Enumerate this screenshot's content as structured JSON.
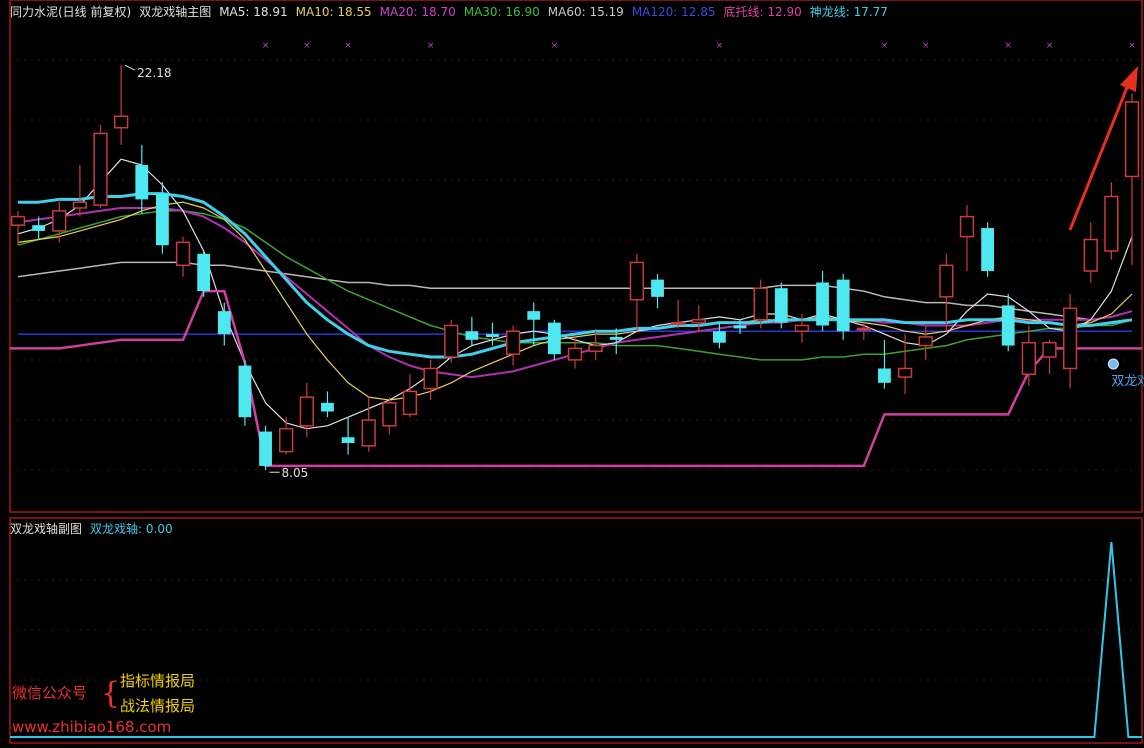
{
  "header": {
    "stock_title": "同力水泥(日线 前复权)",
    "indicator_name": "双龙戏轴主图",
    "items": [
      {
        "label": "MA5: 18.91",
        "color": "#e0e0e0"
      },
      {
        "label": "MA10: 18.55",
        "color": "#e8d060"
      },
      {
        "label": "MA20: 18.70",
        "color": "#d040d0"
      },
      {
        "label": "MA30: 16.90",
        "color": "#40c040"
      },
      {
        "label": "MA60: 15.19",
        "color": "#c8c8c8"
      },
      {
        "label": "MA120: 12.85",
        "color": "#3050e0"
      },
      {
        "label": "底托线: 12.90",
        "color": "#e040a0"
      },
      {
        "label": "神龙线: 17.77",
        "color": "#40d0e8"
      }
    ]
  },
  "sub_header": {
    "name": "双龙戏轴副图",
    "item": "双龙戏轴: 0.00"
  },
  "annotations": {
    "high_label": "22.18",
    "low_label": "8.05",
    "signal_label": "双龙戏轴"
  },
  "watermark": {
    "wechat": "微信公众号",
    "brace": "{",
    "line1": "指标情报局",
    "line2": "战法情报局",
    "url": "www.zhibiao168.com"
  },
  "colors": {
    "up": "#c83c3c",
    "down": "#50e8f0",
    "frame": "#7a1414",
    "ma5": "#e0e0e0",
    "ma10": "#e8d060",
    "ma20": "#b030b0",
    "ma30": "#40a030",
    "ma60": "#b8b8b8",
    "ma120": "#2838d8",
    "base": "#d040a0",
    "dragon": "#40d0e8",
    "sub": "#30c8e8",
    "arrow": "#e83020"
  },
  "chart_data": {
    "type": "candlestick",
    "price_range": [
      7.5,
      23.2
    ],
    "highest": 22.18,
    "lowest": 8.05,
    "candles": [
      [
        16.6,
        16.9,
        17.1,
        15.9
      ],
      [
        16.6,
        16.4,
        16.9,
        16.1
      ],
      [
        16.4,
        17.1,
        17.5,
        16.0
      ],
      [
        17.2,
        17.4,
        18.7,
        16.9
      ],
      [
        17.3,
        19.8,
        20.1,
        17.2
      ],
      [
        20.0,
        20.4,
        22.18,
        19.4
      ],
      [
        18.7,
        17.5,
        19.4,
        17.0
      ],
      [
        17.7,
        15.9,
        18.1,
        15.6
      ],
      [
        15.2,
        16.0,
        16.2,
        14.8
      ],
      [
        15.6,
        14.3,
        15.7,
        14.1
      ],
      [
        13.6,
        12.8,
        13.9,
        12.4
      ],
      [
        11.7,
        9.9,
        11.9,
        9.6
      ],
      [
        9.4,
        8.2,
        9.6,
        8.05
      ],
      [
        8.7,
        9.5,
        9.9,
        8.6
      ],
      [
        9.6,
        10.6,
        11.1,
        9.2
      ],
      [
        10.4,
        10.1,
        10.8,
        9.9
      ],
      [
        9.2,
        9.0,
        9.9,
        8.6
      ],
      [
        8.9,
        9.8,
        10.6,
        8.7
      ],
      [
        9.6,
        10.4,
        10.6,
        9.3
      ],
      [
        10.0,
        10.8,
        11.4,
        9.9
      ],
      [
        10.9,
        11.6,
        11.9,
        10.5
      ],
      [
        12.0,
        13.1,
        13.3,
        11.8
      ],
      [
        12.9,
        12.6,
        13.4,
        12.4
      ],
      [
        12.8,
        12.7,
        13.2,
        12.4
      ],
      [
        12.1,
        12.9,
        13.1,
        11.7
      ],
      [
        13.6,
        13.3,
        13.9,
        12.4
      ],
      [
        13.2,
        12.1,
        13.3,
        11.9
      ],
      [
        11.9,
        12.3,
        12.7,
        11.6
      ],
      [
        12.2,
        12.4,
        12.9,
        11.9
      ],
      [
        12.7,
        12.6,
        13.0,
        12.1
      ],
      [
        14.0,
        15.3,
        15.6,
        12.9
      ],
      [
        14.7,
        14.1,
        14.9,
        13.7
      ],
      [
        13.2,
        13.2,
        14.0,
        13.0
      ],
      [
        13.2,
        13.3,
        13.8,
        12.9
      ],
      [
        12.9,
        12.5,
        13.2,
        12.3
      ],
      [
        13.1,
        13.0,
        13.3,
        12.8
      ],
      [
        13.3,
        14.4,
        14.7,
        13.0
      ],
      [
        14.4,
        13.2,
        14.6,
        13.0
      ],
      [
        12.9,
        13.1,
        13.5,
        12.5
      ],
      [
        14.6,
        13.1,
        15.0,
        12.9
      ],
      [
        14.7,
        12.9,
        14.9,
        12.6
      ],
      [
        13.0,
        13.0,
        13.2,
        12.6
      ],
      [
        11.6,
        11.1,
        12.6,
        10.9
      ],
      [
        11.3,
        11.6,
        12.8,
        10.7
      ],
      [
        12.4,
        12.7,
        13.1,
        11.9
      ],
      [
        14.1,
        15.2,
        15.6,
        12.9
      ],
      [
        16.2,
        16.9,
        17.3,
        15.0
      ],
      [
        16.5,
        15.0,
        16.7,
        14.8
      ],
      [
        13.8,
        12.4,
        14.2,
        12.2
      ],
      [
        11.4,
        12.5,
        13.1,
        11.0
      ],
      [
        12.0,
        12.5,
        12.6,
        11.4
      ],
      [
        11.6,
        13.7,
        14.2,
        10.9
      ],
      [
        15.0,
        16.1,
        16.7,
        14.6
      ],
      [
        15.7,
        17.6,
        18.1,
        15.4
      ],
      [
        18.3,
        20.9,
        21.2,
        15.2
      ]
    ],
    "lines": {
      "MA5": [
        16.3,
        16.5,
        16.8,
        17.3,
        18.1,
        18.9,
        18.7,
        18.0,
        17.1,
        15.7,
        13.5,
        11.8,
        10.4,
        9.7,
        9.5,
        9.6,
        9.9,
        10.2,
        10.5,
        10.9,
        11.4,
        12.0,
        12.4,
        12.6,
        12.8,
        12.9,
        12.8,
        12.6,
        12.4,
        12.5,
        12.9,
        13.1,
        13.2,
        13.3,
        13.4,
        13.3,
        13.5,
        13.5,
        13.3,
        13.5,
        13.3,
        13.1,
        12.8,
        12.5,
        12.4,
        12.8,
        13.6,
        14.2,
        14.1,
        13.6,
        13.0,
        12.9,
        13.3,
        14.3,
        16.2
      ],
      "MA10": [
        16.0,
        16.1,
        16.2,
        16.4,
        16.6,
        16.8,
        17.1,
        17.3,
        17.4,
        17.2,
        16.8,
        16.1,
        15.0,
        13.9,
        12.8,
        11.9,
        11.1,
        10.6,
        10.5,
        10.6,
        10.8,
        11.1,
        11.5,
        11.8,
        12.1,
        12.4,
        12.6,
        12.7,
        12.8,
        12.8,
        12.9,
        13.0,
        13.1,
        13.1,
        13.2,
        13.2,
        13.3,
        13.3,
        13.3,
        13.4,
        13.3,
        13.2,
        13.1,
        12.9,
        12.8,
        12.9,
        13.1,
        13.3,
        13.4,
        13.3,
        13.2,
        13.1,
        13.2,
        13.5,
        14.2
      ],
      "MA20": [
        16.7,
        16.8,
        16.9,
        17.0,
        17.1,
        17.2,
        17.2,
        17.2,
        17.1,
        16.9,
        16.5,
        16.0,
        15.4,
        14.8,
        14.2,
        13.6,
        13.0,
        12.4,
        12.0,
        11.7,
        11.5,
        11.4,
        11.3,
        11.4,
        11.5,
        11.7,
        11.9,
        12.1,
        12.3,
        12.5,
        12.6,
        12.7,
        12.8,
        12.9,
        13.0,
        13.1,
        13.2,
        13.2,
        13.3,
        13.3,
        13.3,
        13.3,
        13.2,
        13.2,
        13.1,
        13.1,
        13.1,
        13.2,
        13.3,
        13.3,
        13.3,
        13.3,
        13.3,
        13.4,
        13.6
      ],
      "MA30": [
        15.9,
        16.1,
        16.3,
        16.5,
        16.7,
        16.9,
        17.0,
        17.1,
        17.1,
        17.0,
        16.8,
        16.5,
        16.0,
        15.5,
        15.1,
        14.7,
        14.3,
        14.0,
        13.7,
        13.4,
        13.1,
        12.9,
        12.7,
        12.6,
        12.5,
        12.5,
        12.5,
        12.5,
        12.5,
        12.4,
        12.4,
        12.4,
        12.3,
        12.2,
        12.1,
        12.0,
        11.9,
        11.9,
        11.9,
        12.0,
        12.0,
        12.1,
        12.1,
        12.2,
        12.3,
        12.4,
        12.6,
        12.7,
        12.8,
        12.9,
        13.0,
        13.0,
        13.1,
        13.1,
        13.3
      ],
      "MA60": [
        14.8,
        14.9,
        15.0,
        15.1,
        15.2,
        15.3,
        15.3,
        15.3,
        15.3,
        15.2,
        15.2,
        15.1,
        15.0,
        14.9,
        14.8,
        14.7,
        14.6,
        14.6,
        14.5,
        14.5,
        14.4,
        14.4,
        14.4,
        14.4,
        14.4,
        14.4,
        14.4,
        14.4,
        14.4,
        14.4,
        14.4,
        14.4,
        14.4,
        14.4,
        14.4,
        14.4,
        14.4,
        14.5,
        14.5,
        14.5,
        14.4,
        14.3,
        14.1,
        14.0,
        13.9,
        13.9,
        13.8,
        13.8,
        13.7,
        13.6,
        13.5,
        13.4,
        13.3,
        13.4,
        13.6
      ],
      "MA120": [
        12.8,
        12.8,
        12.8,
        12.8,
        12.8,
        12.8,
        12.8,
        12.8,
        12.8,
        12.8,
        12.8,
        12.8,
        12.8,
        12.8,
        12.8,
        12.8,
        12.8,
        12.8,
        12.8,
        12.8,
        12.8,
        12.8,
        12.8,
        12.8,
        12.8,
        12.9,
        12.9,
        12.9,
        12.9,
        12.9,
        12.9,
        12.9,
        12.9,
        12.9,
        12.9,
        12.9,
        12.9,
        12.9,
        12.9,
        12.9,
        12.9,
        12.9,
        12.9,
        12.9,
        12.9,
        12.9,
        12.9,
        12.9,
        12.9,
        12.9,
        12.9,
        12.9,
        12.9,
        12.9,
        12.9
      ],
      "底托线": [
        12.3,
        12.3,
        12.3,
        12.4,
        12.5,
        12.6,
        12.6,
        12.6,
        12.6,
        14.3,
        14.3,
        11.8,
        8.2,
        8.2,
        8.2,
        8.2,
        8.2,
        8.2,
        8.2,
        8.2,
        8.2,
        8.2,
        8.2,
        8.2,
        8.2,
        8.2,
        8.2,
        8.2,
        8.2,
        8.2,
        8.2,
        8.2,
        8.2,
        8.2,
        8.2,
        8.2,
        8.2,
        8.2,
        8.2,
        8.2,
        8.2,
        8.2,
        10.0,
        10.0,
        10.0,
        10.0,
        10.0,
        10.0,
        10.0,
        11.5,
        12.3,
        12.3,
        12.3,
        12.3,
        12.3
      ],
      "神龙线": [
        17.4,
        17.4,
        17.5,
        17.5,
        17.6,
        17.6,
        17.7,
        17.7,
        17.6,
        17.4,
        16.9,
        16.3,
        15.5,
        14.7,
        13.9,
        13.3,
        12.8,
        12.4,
        12.2,
        12.1,
        12.0,
        12.0,
        12.1,
        12.3,
        12.5,
        12.6,
        12.7,
        12.8,
        12.9,
        12.9,
        13.0,
        13.0,
        13.1,
        13.1,
        13.2,
        13.2,
        13.2,
        13.3,
        13.3,
        13.3,
        13.3,
        13.3,
        13.3,
        13.2,
        13.2,
        13.2,
        13.3,
        13.3,
        13.3,
        13.2,
        13.2,
        13.1,
        13.1,
        13.2,
        13.3
      ]
    },
    "sub_series": {
      "name": "双龙戏轴",
      "signal_index": 53,
      "signal_value": 1,
      "current": 0.0
    },
    "signal_markers": [
      12,
      14,
      16,
      20,
      26,
      34,
      42,
      44,
      48,
      50,
      54
    ]
  }
}
